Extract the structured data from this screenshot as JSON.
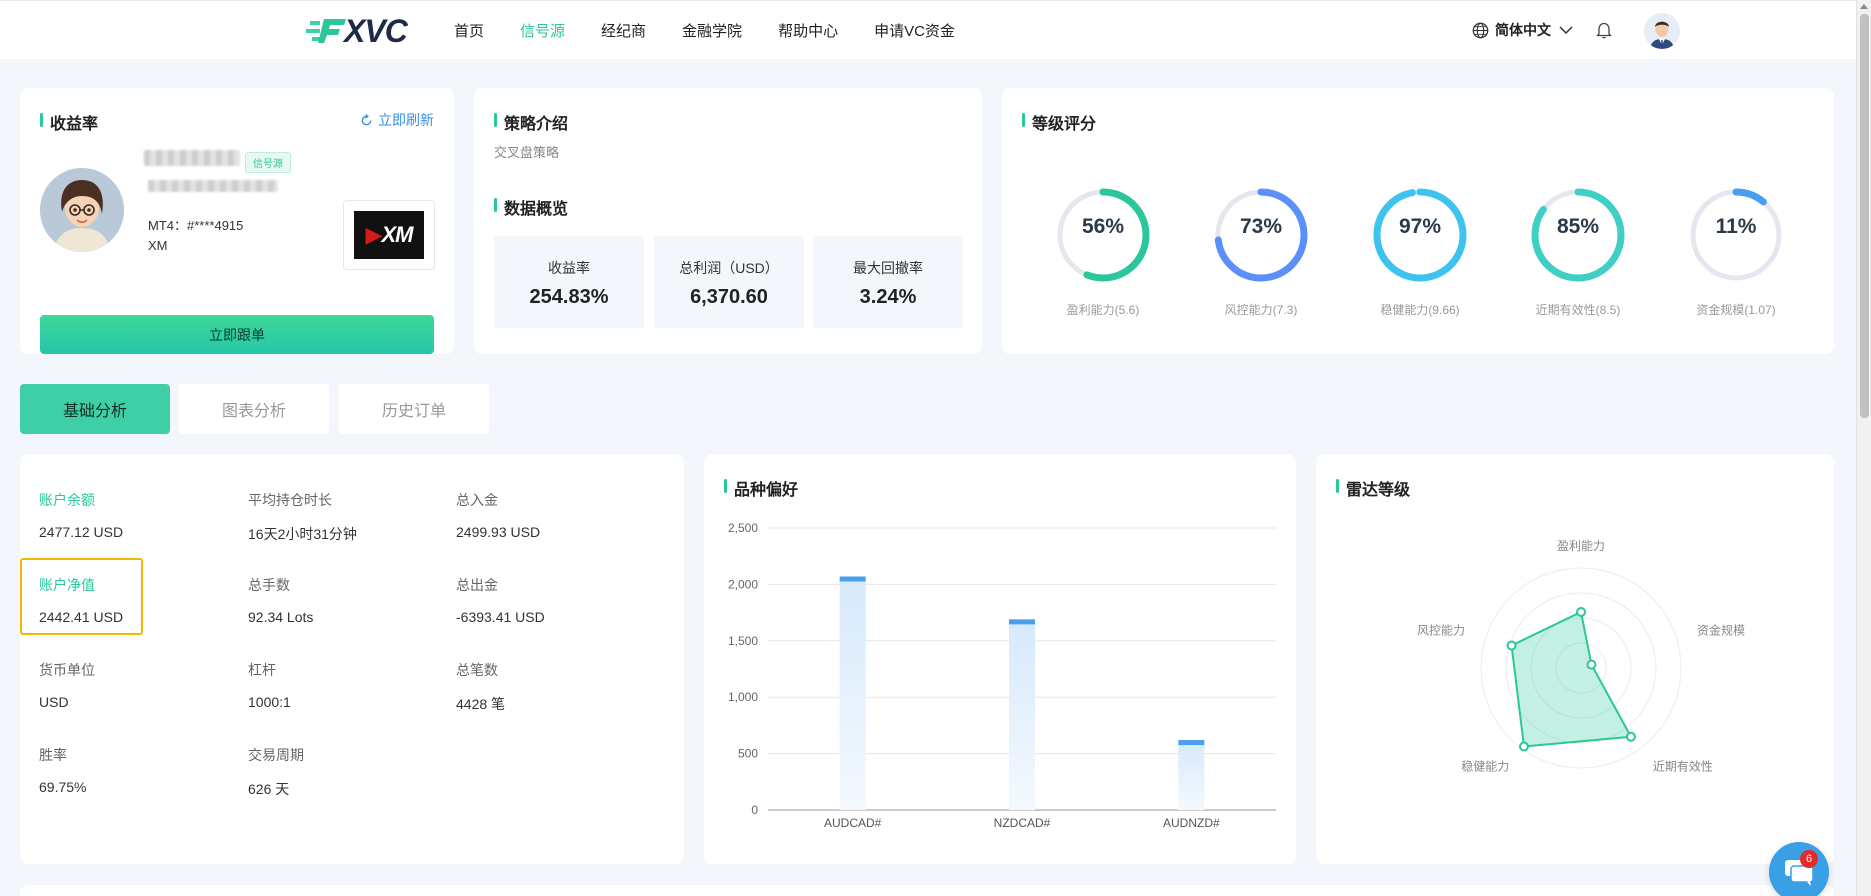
{
  "brand": {
    "logo_text": "XVC",
    "accent": "#2bc69b"
  },
  "nav": {
    "items": [
      {
        "label": "首页",
        "active": false
      },
      {
        "label": "信号源",
        "active": true
      },
      {
        "label": "经纪商",
        "active": false
      },
      {
        "label": "金融学院",
        "active": false
      },
      {
        "label": "帮助中心",
        "active": false
      },
      {
        "label": "申请VC资金",
        "active": false
      }
    ],
    "language": "简体中文"
  },
  "profile": {
    "section_title": "收益率",
    "refresh_label": "立即刷新",
    "tag": "信号源",
    "account_line": "MT4：#****4915",
    "broker_line": "XM",
    "broker_logo_text": "XM",
    "follow_button": "立即跟单"
  },
  "strategy": {
    "section_title": "策略介绍",
    "description": "交叉盘策略",
    "overview_title": "数据概览",
    "stats": [
      {
        "label": "收益率",
        "value": "254.83%"
      },
      {
        "label": "总利润（USD）",
        "value": "6,370.60"
      },
      {
        "label": "最大回撤率",
        "value": "3.24%"
      }
    ]
  },
  "rating": {
    "section_title": "等级评分",
    "gauges": [
      {
        "percent": "56%",
        "value": 0.56,
        "label": "盈利能力(5.6)",
        "color": "#2bc69b"
      },
      {
        "percent": "73%",
        "value": 0.73,
        "label": "风控能力(7.3)",
        "color": "#5b8ff9"
      },
      {
        "percent": "97%",
        "value": 0.97,
        "label": "稳健能力(9.66)",
        "color": "#3ec3f0"
      },
      {
        "percent": "85%",
        "value": 0.85,
        "label": "近期有效性(8.5)",
        "color": "#3fcfc5"
      },
      {
        "percent": "11%",
        "value": 0.11,
        "label": "资金规模(1.07)",
        "color": "#4a9ef0"
      }
    ]
  },
  "tabs": [
    {
      "label": "基础分析",
      "active": true
    },
    {
      "label": "图表分析",
      "active": false
    },
    {
      "label": "历史订单",
      "active": false
    }
  ],
  "basic": {
    "cells": [
      {
        "key": "账户余额",
        "value": "2477.12 USD",
        "green": true
      },
      {
        "key": "平均持仓时长",
        "value": "16天2小时31分钟",
        "green": false
      },
      {
        "key": "总入金",
        "value": "2499.93 USD",
        "green": false
      },
      {
        "key": "账户净值",
        "value": "2442.41 USD",
        "green": true
      },
      {
        "key": "总手数",
        "value": "92.34 Lots",
        "green": false
      },
      {
        "key": "总出金",
        "value": "-6393.41 USD",
        "green": false
      },
      {
        "key": "货币单位",
        "value": "USD",
        "green": false
      },
      {
        "key": "杠杆",
        "value": "1000:1",
        "green": false
      },
      {
        "key": "总笔数",
        "value": "4428 笔",
        "green": false
      },
      {
        "key": "胜率",
        "value": "69.75%",
        "green": false
      },
      {
        "key": "交易周期",
        "value": "626 天",
        "green": false
      }
    ]
  },
  "chart_data": [
    {
      "type": "bar",
      "title": "品种偏好",
      "categories": [
        "AUDCAD#",
        "NZDCAD#",
        "AUDNZD#"
      ],
      "values": [
        2070,
        1690,
        620
      ],
      "yticks": [
        "0",
        "500",
        "1,000",
        "1,500",
        "2,000",
        "2,500"
      ],
      "ylim": [
        0,
        2500
      ],
      "grid": true,
      "color": "#4a9ef0"
    },
    {
      "type": "radar",
      "title": "雷达等级",
      "axes": [
        "盈利能力",
        "资金规模",
        "近期有效性",
        "稳健能力",
        "风控能力"
      ],
      "values": [
        0.56,
        0.11,
        0.85,
        0.97,
        0.73
      ],
      "range": [
        0,
        1
      ],
      "color": "#2bc69b"
    }
  ],
  "chat": {
    "badge": "6"
  }
}
